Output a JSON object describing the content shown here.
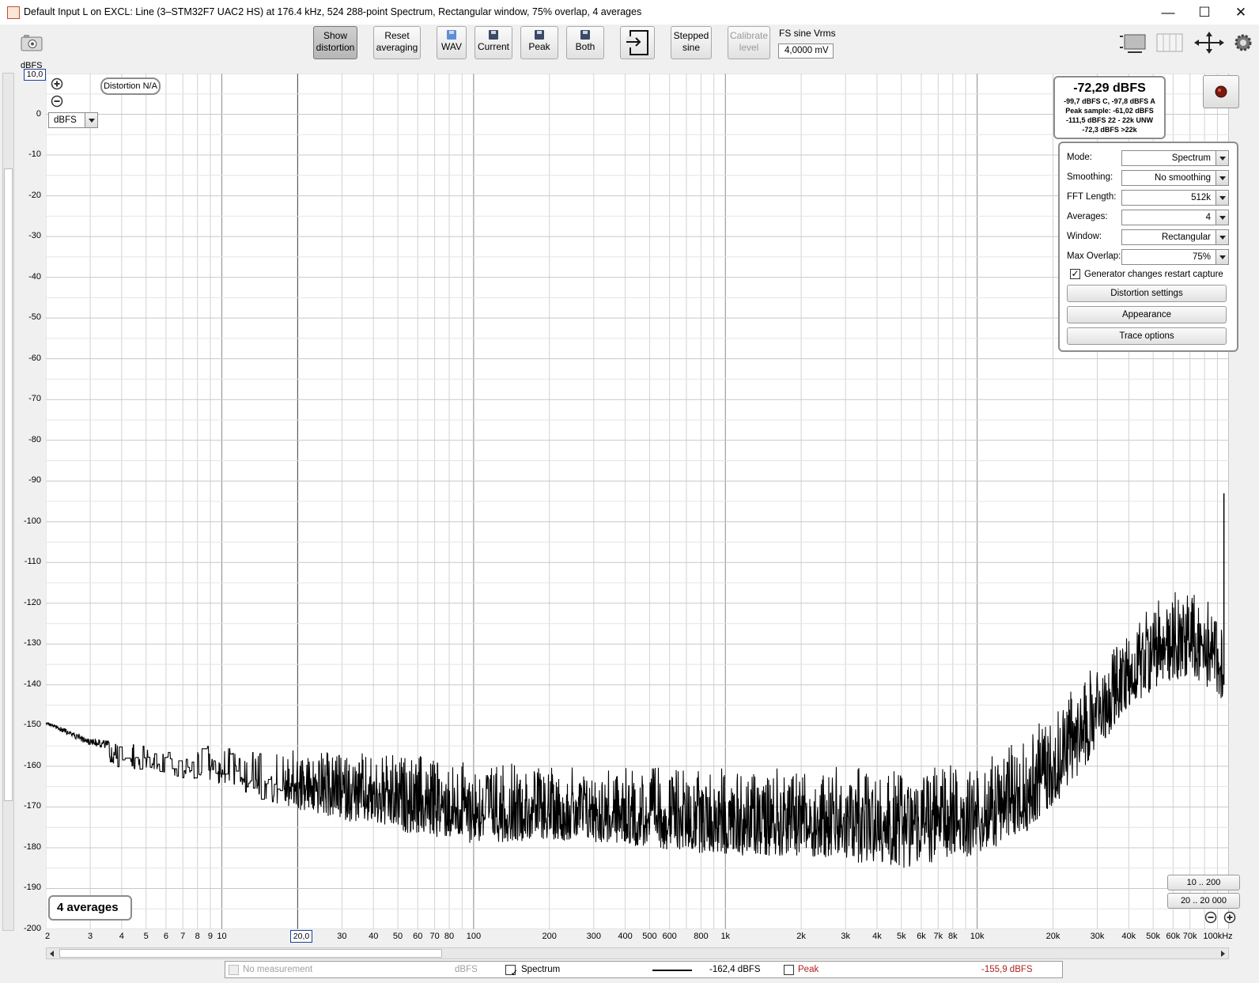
{
  "window": {
    "title": "Default Input L on EXCL: Line (3–STM32F7 UAC2 HS) at 176.4 kHz, 524 288-point Spectrum, Rectangular window, 75% overlap, 4 averages",
    "minimize": "—",
    "maximize": "☐",
    "close": "✕"
  },
  "toolbar": {
    "show_distortion": [
      "Show",
      "distortion"
    ],
    "reset_averaging": [
      "Reset",
      "averaging"
    ],
    "wav": "WAV",
    "current": "Current",
    "peak": "Peak",
    "both": "Both",
    "stepped_sine": [
      "Stepped",
      "sine"
    ],
    "calibrate_level": [
      "Calibrate",
      "level"
    ],
    "fs_label": "FS sine Vrms",
    "fs_value": "4,0000 mV"
  },
  "plot": {
    "y_unit": "dBFS",
    "y_max_box": "10,0",
    "x_highlight": "20,0",
    "distortion_badge": "Distortion N/A",
    "unit_select": "dBFS",
    "averages_badge": "4 averages",
    "range_buttons": [
      "10 .. 200",
      "20 .. 20 000"
    ]
  },
  "readout": {
    "main": "-72,29 dBFS",
    "lines": [
      "-99,7 dBFS C, -97,8 dBFS A",
      "Peak sample: -61,02 dBFS",
      "-111,5 dBFS 22 - 22k UNW",
      "-72,3 dBFS >22k"
    ]
  },
  "panel": {
    "rows": [
      {
        "label": "Mode:",
        "value": "Spectrum"
      },
      {
        "label": "Smoothing:",
        "value": "No  smoothing"
      },
      {
        "label": "FFT Length:",
        "value": "512k"
      },
      {
        "label": "Averages:",
        "value": "4"
      },
      {
        "label": "Window:",
        "value": "Rectangular"
      },
      {
        "label": "Max Overlap:",
        "value": "75%"
      }
    ],
    "checkbox_label": "Generator changes restart capture",
    "checkbox_checked": true,
    "buttons": [
      "Distortion settings",
      "Appearance",
      "Trace options"
    ]
  },
  "legend": {
    "no_measurement": "No measurement",
    "no_measurement_unit": "dBFS",
    "spectrum_label": "Spectrum",
    "spectrum_value": "-162,4 dBFS",
    "peak_label": "Peak",
    "peak_value": "-155,9 dBFS"
  },
  "chart_data": {
    "type": "line",
    "title": "",
    "xlabel": "",
    "ylabel": "dBFS",
    "x_scale": "log",
    "xlim": [
      2,
      100000
    ],
    "ylim": [
      -200,
      10
    ],
    "grid": true,
    "y_ticks": [
      0,
      -10,
      -20,
      -30,
      -40,
      -50,
      -60,
      -70,
      -80,
      -90,
      -100,
      -110,
      -120,
      -130,
      -140,
      -150,
      -160,
      -170,
      -180,
      -190,
      -200
    ],
    "x_ticks": [
      {
        "v": 2,
        "label": "2"
      },
      {
        "v": 3,
        "label": "3"
      },
      {
        "v": 4,
        "label": "4"
      },
      {
        "v": 5,
        "label": "5"
      },
      {
        "v": 6,
        "label": "6"
      },
      {
        "v": 7,
        "label": "7"
      },
      {
        "v": 8,
        "label": "8"
      },
      {
        "v": 9,
        "label": "9"
      },
      {
        "v": 10,
        "label": "10"
      },
      {
        "v": 30,
        "label": "30"
      },
      {
        "v": 40,
        "label": "40"
      },
      {
        "v": 50,
        "label": "50"
      },
      {
        "v": 60,
        "label": "60"
      },
      {
        "v": 70,
        "label": "70"
      },
      {
        "v": 80,
        "label": "80"
      },
      {
        "v": 100,
        "label": "100"
      },
      {
        "v": 200,
        "label": "200"
      },
      {
        "v": 300,
        "label": "300"
      },
      {
        "v": 400,
        "label": "400"
      },
      {
        "v": 500,
        "label": "500"
      },
      {
        "v": 600,
        "label": "600"
      },
      {
        "v": 800,
        "label": "800"
      },
      {
        "v": 1000,
        "label": "1k"
      },
      {
        "v": 2000,
        "label": "2k"
      },
      {
        "v": 3000,
        "label": "3k"
      },
      {
        "v": 4000,
        "label": "4k"
      },
      {
        "v": 5000,
        "label": "5k"
      },
      {
        "v": 6000,
        "label": "6k"
      },
      {
        "v": 7000,
        "label": "7k"
      },
      {
        "v": 8000,
        "label": "8k"
      },
      {
        "v": 10000,
        "label": "10k"
      },
      {
        "v": 20000,
        "label": "20k"
      },
      {
        "v": 30000,
        "label": "30k"
      },
      {
        "v": 40000,
        "label": "40k"
      },
      {
        "v": 50000,
        "label": "50k"
      },
      {
        "v": 60000,
        "label": "60k"
      },
      {
        "v": 70000,
        "label": "70k"
      },
      {
        "v": 100000,
        "label": "100kHz"
      }
    ],
    "series": [
      {
        "name": "Spectrum",
        "color": "#000000",
        "envelope": [
          {
            "x": 2,
            "hi": -149,
            "lo": -151
          },
          {
            "x": 3,
            "hi": -153,
            "lo": -160
          },
          {
            "x": 5,
            "hi": -155,
            "lo": -161
          },
          {
            "x": 10,
            "hi": -155,
            "lo": -165
          },
          {
            "x": 20,
            "hi": -156,
            "lo": -171
          },
          {
            "x": 50,
            "hi": -157,
            "lo": -176
          },
          {
            "x": 100,
            "hi": -158,
            "lo": -179
          },
          {
            "x": 200,
            "hi": -160,
            "lo": -178
          },
          {
            "x": 500,
            "hi": -160,
            "lo": -180
          },
          {
            "x": 1000,
            "hi": -160,
            "lo": -182
          },
          {
            "x": 2000,
            "hi": -160,
            "lo": -182
          },
          {
            "x": 5000,
            "hi": -160,
            "lo": -185
          },
          {
            "x": 10000,
            "hi": -159,
            "lo": -182
          },
          {
            "x": 15000,
            "hi": -153,
            "lo": -177
          },
          {
            "x": 20000,
            "hi": -146,
            "lo": -170
          },
          {
            "x": 30000,
            "hi": -134,
            "lo": -156
          },
          {
            "x": 40000,
            "hi": -126,
            "lo": -146
          },
          {
            "x": 50000,
            "hi": -120,
            "lo": -141
          },
          {
            "x": 60000,
            "hi": -117,
            "lo": -139
          },
          {
            "x": 70000,
            "hi": -115,
            "lo": -138
          },
          {
            "x": 80000,
            "hi": -117,
            "lo": -140
          },
          {
            "x": 90000,
            "hi": -122,
            "lo": -143
          },
          {
            "x": 95000,
            "hi": -124,
            "lo": -144
          }
        ],
        "spike": {
          "x": 95500,
          "y": -93
        }
      }
    ]
  }
}
